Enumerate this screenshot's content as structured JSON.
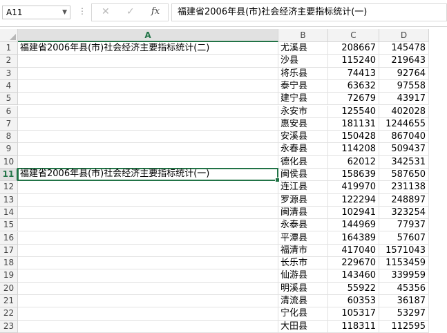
{
  "formula_bar": {
    "name_box": "A11",
    "content": "福建省2006年县(市)社会经济主要指标统计(一)",
    "fx_label": "fx"
  },
  "columns": [
    "A",
    "B",
    "C",
    "D"
  ],
  "selected_cell": "A11",
  "rows": [
    {
      "n": "1",
      "a": "福建省2006年县(市)社会经济主要指标统计(二)",
      "b": "尤溪县",
      "c": "208667",
      "d": "145478"
    },
    {
      "n": "2",
      "a": "",
      "b": "沙县",
      "c": "115240",
      "d": "219643"
    },
    {
      "n": "3",
      "a": "",
      "b": "将乐县",
      "c": "74413",
      "d": "92764"
    },
    {
      "n": "4",
      "a": "",
      "b": "泰宁县",
      "c": "63632",
      "d": "97558"
    },
    {
      "n": "5",
      "a": "",
      "b": "建宁县",
      "c": "72679",
      "d": "43917"
    },
    {
      "n": "6",
      "a": "",
      "b": "永安市",
      "c": "125540",
      "d": "402028"
    },
    {
      "n": "7",
      "a": "",
      "b": "惠安县",
      "c": "181131",
      "d": "1244655"
    },
    {
      "n": "8",
      "a": "",
      "b": "安溪县",
      "c": "150428",
      "d": "867040"
    },
    {
      "n": "9",
      "a": "",
      "b": "永春县",
      "c": "114208",
      "d": "509437"
    },
    {
      "n": "10",
      "a": "",
      "b": "德化县",
      "c": "62012",
      "d": "342531"
    },
    {
      "n": "11",
      "a": "福建省2006年县(市)社会经济主要指标统计(一)",
      "b": "闽侯县",
      "c": "158639",
      "d": "587650"
    },
    {
      "n": "12",
      "a": "",
      "b": "连江县",
      "c": "419970",
      "d": "231138"
    },
    {
      "n": "13",
      "a": "",
      "b": "罗源县",
      "c": "122294",
      "d": "248897"
    },
    {
      "n": "14",
      "a": "",
      "b": "闽清县",
      "c": "102941",
      "d": "323254"
    },
    {
      "n": "15",
      "a": "",
      "b": "永泰县",
      "c": "144969",
      "d": "77937"
    },
    {
      "n": "16",
      "a": "",
      "b": "平潭县",
      "c": "164389",
      "d": "57607"
    },
    {
      "n": "17",
      "a": "",
      "b": "福清市",
      "c": "417040",
      "d": "1571043"
    },
    {
      "n": "18",
      "a": "",
      "b": "长乐市",
      "c": "229670",
      "d": "1153459"
    },
    {
      "n": "19",
      "a": "",
      "b": "仙游县",
      "c": "143460",
      "d": "339959"
    },
    {
      "n": "20",
      "a": "",
      "b": "明溪县",
      "c": "55922",
      "d": "45356"
    },
    {
      "n": "21",
      "a": "",
      "b": "清流县",
      "c": "60353",
      "d": "36187"
    },
    {
      "n": "22",
      "a": "",
      "b": "宁化县",
      "c": "105317",
      "d": "53297"
    },
    {
      "n": "23",
      "a": "",
      "b": "大田县",
      "c": "118311",
      "d": "112595"
    }
  ]
}
